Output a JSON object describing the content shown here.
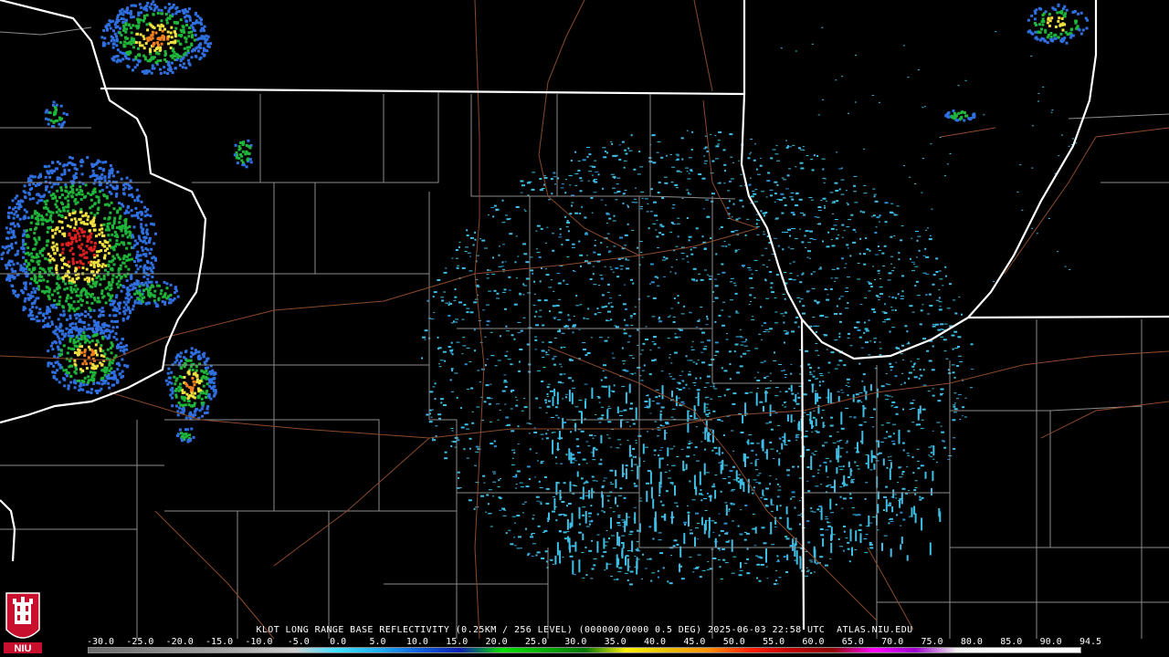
{
  "product": {
    "caption": "KLOT LONG RANGE BASE REFLECTIVITY (0.25KM / 256 LEVEL) (000000/0000 0.5 DEG) 2025-06-03 22:58 UTC  ATLAS.NIU.EDU"
  },
  "scale": {
    "labels": [
      "-30.0",
      "-25.0",
      "-20.0",
      "-15.0",
      "-10.0",
      "-5.0",
      "0.0",
      "5.0",
      "10.0",
      "15.0",
      "20.0",
      "25.0",
      "30.0",
      "35.0",
      "40.0",
      "45.0",
      "50.0",
      "55.0",
      "60.0",
      "65.0",
      "70.0",
      "75.0",
      "80.0",
      "85.0",
      "90.0",
      "94.5"
    ],
    "colors": [
      "#6b6b6b",
      "#7a7a7a",
      "#8c8c8c",
      "#9e9e9e",
      "#b4b4b4",
      "#cfcfcf",
      "#40e0ff",
      "#20b0f0",
      "#1060e0",
      "#0a20b0",
      "#00e000",
      "#00b000",
      "#007800",
      "#fff000",
      "#e8c000",
      "#ff9000",
      "#ff2000",
      "#c00000",
      "#900000",
      "#ff00ff",
      "#a000d0",
      "#f0f0f0",
      "#ffffff",
      "#ffffff",
      "#ffffff"
    ]
  },
  "colors": {
    "state_border": "#ffffff",
    "county_border": "#8c8c8c",
    "highway": "#8b4a2b",
    "clear_air_echo": "#3fbfe6",
    "echo_light": "#2f6fe0",
    "echo_green": "#1fb53a",
    "echo_yellow": "#f0e040",
    "echo_orange": "#f08020",
    "echo_red": "#e02020"
  },
  "logo": {
    "text": "NIU"
  }
}
